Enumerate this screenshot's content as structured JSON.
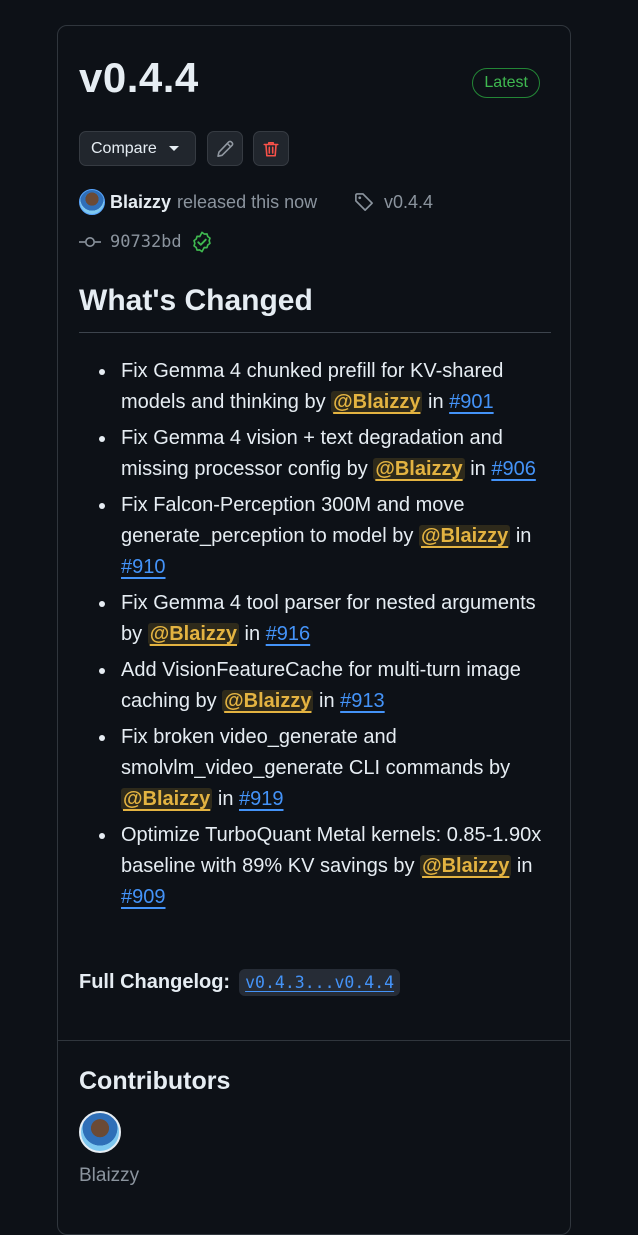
{
  "release": {
    "title": "v0.4.4",
    "latest_badge": "Latest",
    "compare_label": "Compare",
    "author": "Blaizzy",
    "released_text": "released this now",
    "tag": "v0.4.4",
    "commit": "90732bd"
  },
  "changes": {
    "heading": "What's Changed",
    "items": [
      {
        "text": "Fix Gemma 4 chunked prefill for KV-shared models and thinking by ",
        "mention": "@Blaizzy",
        "in": " in ",
        "pr": "#901"
      },
      {
        "text": "Fix Gemma 4 vision + text degradation and missing processor config by ",
        "mention": "@Blaizzy",
        "in": " in ",
        "pr": "#906"
      },
      {
        "text": "Fix Falcon-Perception 300M and move generate_perception to model by ",
        "mention": "@Blaizzy",
        "in": " in ",
        "pr": "#910"
      },
      {
        "text": "Fix Gemma 4 tool parser for nested arguments by ",
        "mention": "@Blaizzy",
        "in": " in ",
        "pr": "#916"
      },
      {
        "text": "Add VisionFeatureCache for multi-turn image caching by ",
        "mention": "@Blaizzy",
        "in": " in ",
        "pr": "#913"
      },
      {
        "text": "Fix broken video_generate and smolvlm_video_generate CLI commands by ",
        "mention": "@Blaizzy",
        "in": " in ",
        "pr": "#919"
      },
      {
        "text": "Optimize TurboQuant Metal kernels: 0.85-1.90x baseline with 89% KV savings by ",
        "mention": "@Blaizzy",
        "in": " in ",
        "pr": "#909"
      }
    ],
    "full_changelog_label": "Full Changelog:",
    "full_changelog_range": "v0.4.3...v0.4.4"
  },
  "contributors": {
    "heading": "Contributors",
    "names": [
      "Blaizzy"
    ]
  },
  "colors": {
    "background": "#0d1117",
    "mention": "#e3b341",
    "link": "#4493f8",
    "latest": "#3fb950",
    "delete": "#f85149"
  },
  "icons": [
    "pencil-icon",
    "trash-icon",
    "tag-icon",
    "commit-icon",
    "verified-check-icon"
  ]
}
